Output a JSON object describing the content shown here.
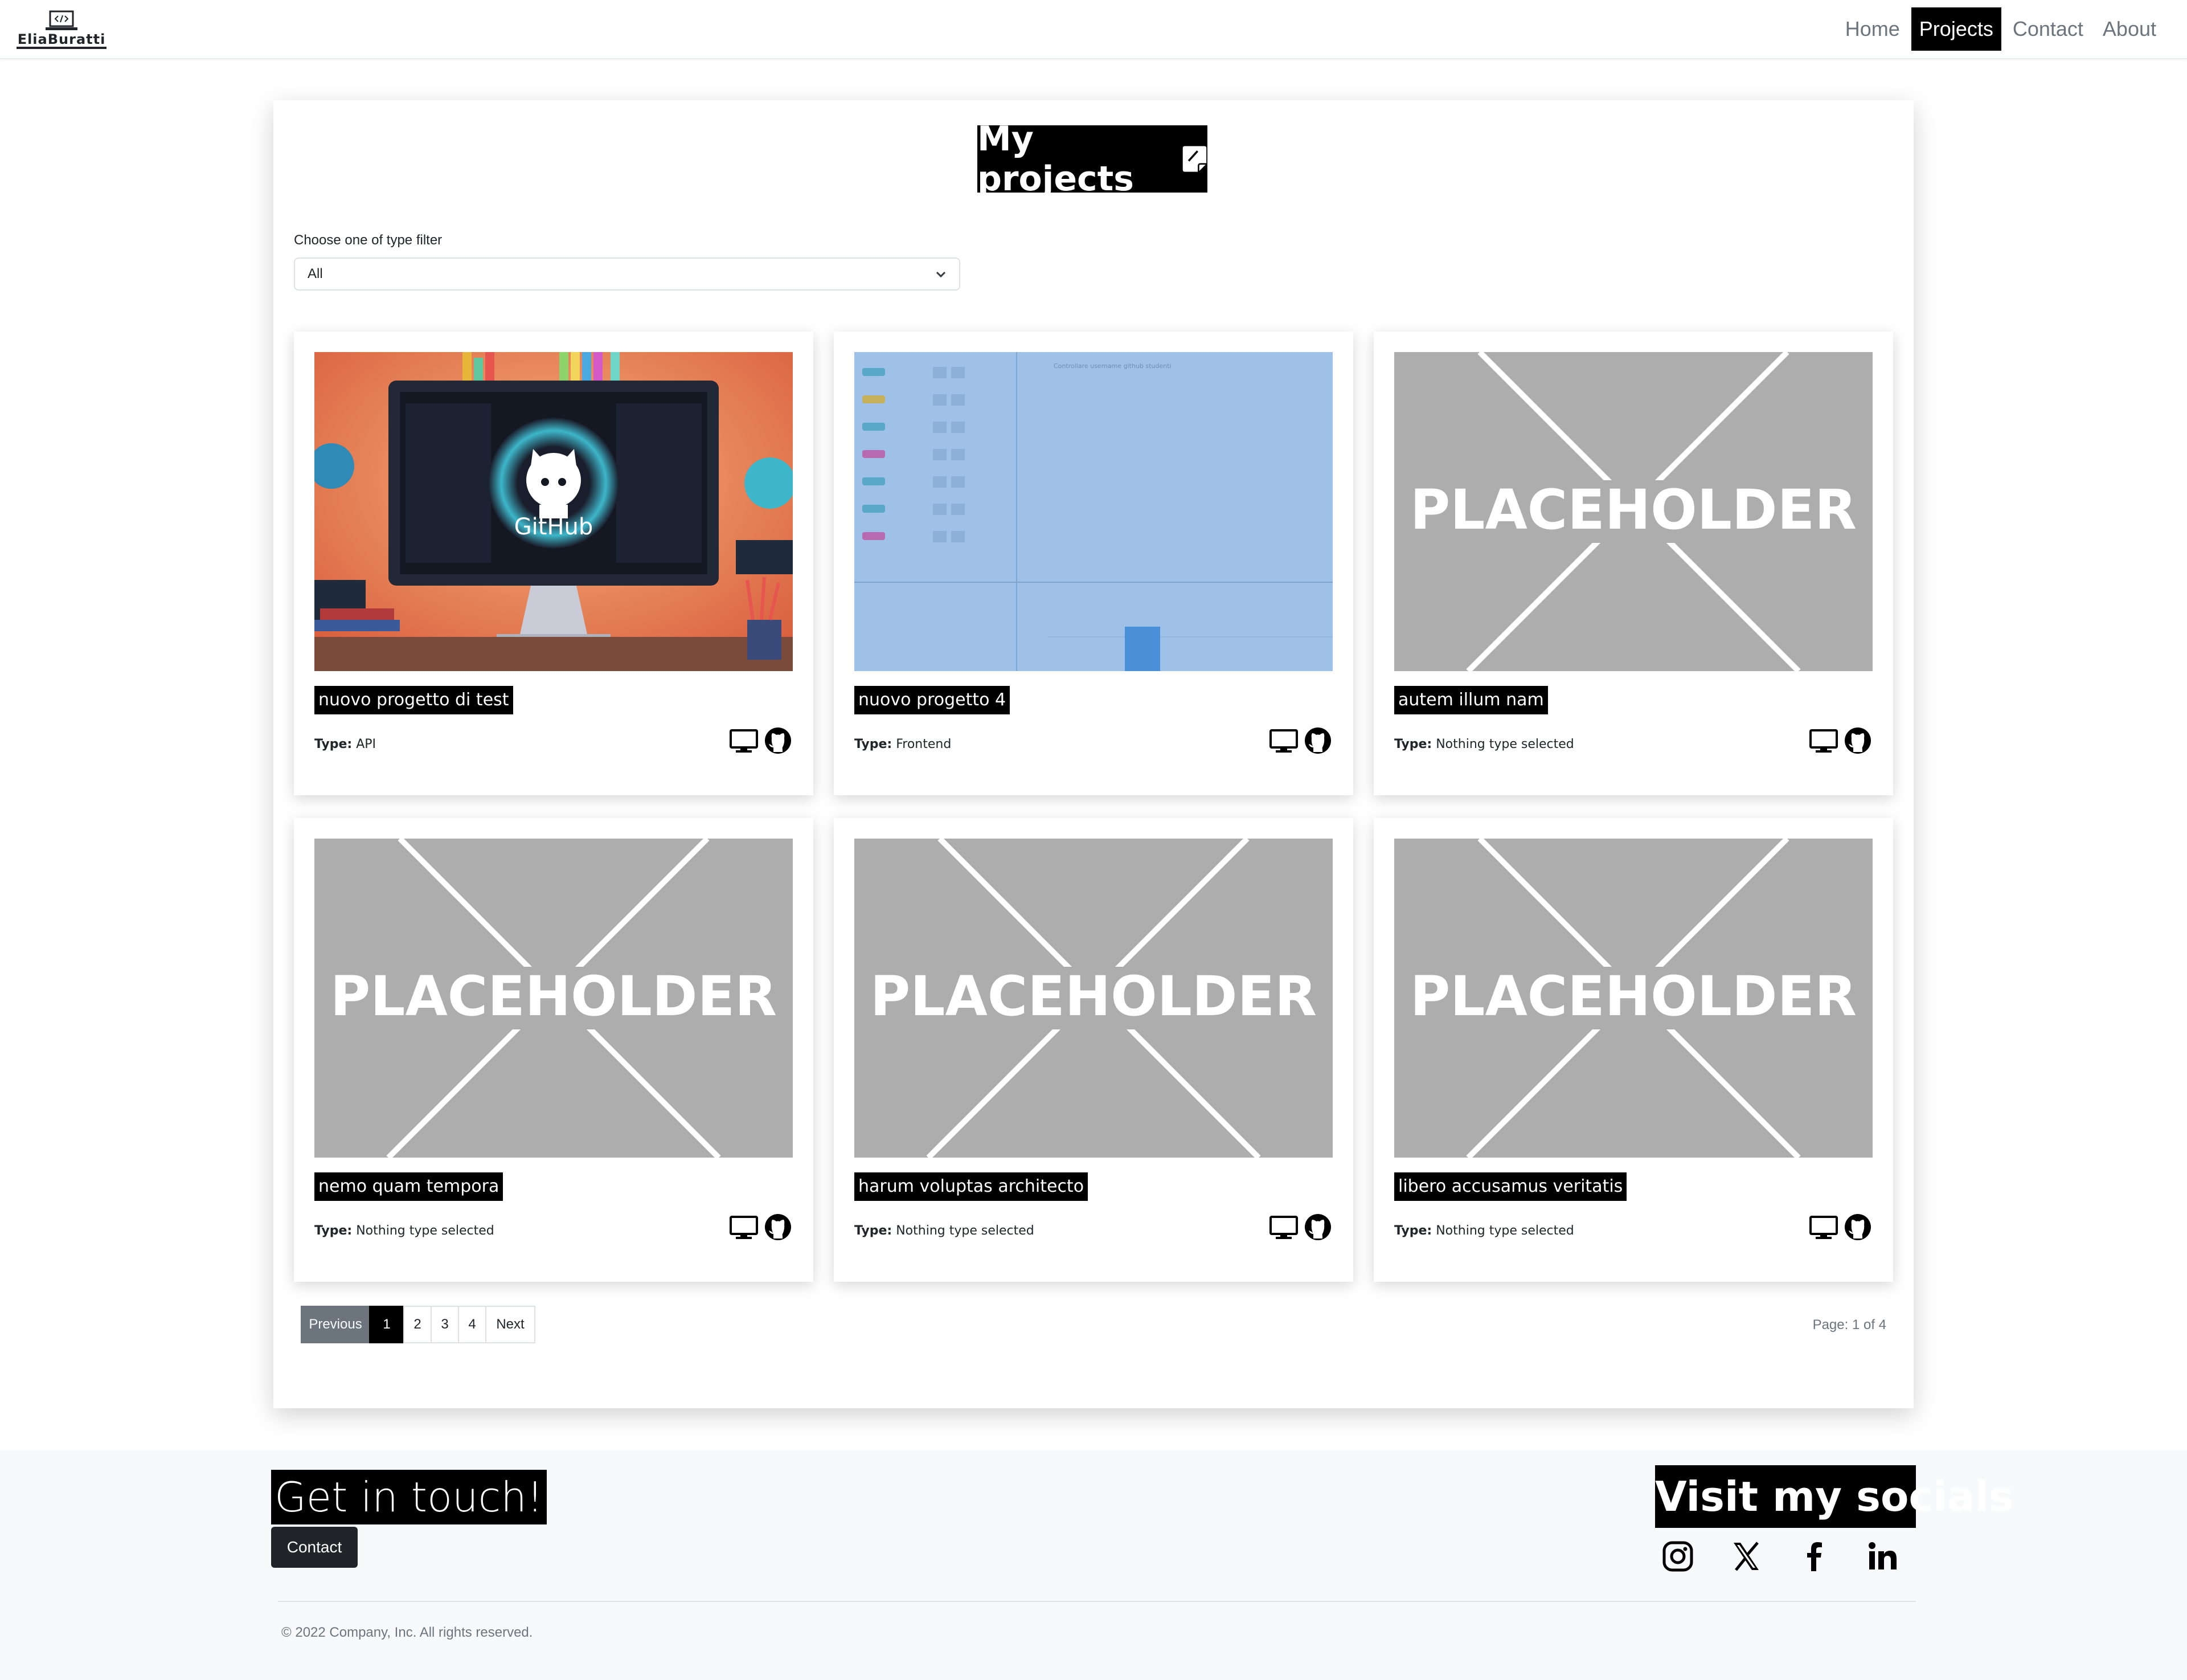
{
  "navbar": {
    "logo_text": "EliaBuratti",
    "links": [
      {
        "label": "Home",
        "active": false
      },
      {
        "label": "Projects",
        "active": true
      },
      {
        "label": "Contact",
        "active": false
      },
      {
        "label": "About",
        "active": false
      }
    ]
  },
  "main": {
    "title": "My projects",
    "filter": {
      "label": "Choose one of type filter",
      "selected": "All"
    },
    "projects": [
      {
        "title": "nuovo progetto di test",
        "type_label": "Type:",
        "type_value": "API",
        "image": "github-illustration"
      },
      {
        "title": "nuovo progetto 4",
        "type_label": "Type:",
        "type_value": "Frontend",
        "image": "blue-dashboard-screenshot",
        "image_caption": "Controllare username github studenti"
      },
      {
        "title": "autem illum nam",
        "type_label": "Type:",
        "type_value": "Nothing type selected",
        "image": "placeholder"
      },
      {
        "title": "nemo quam tempora",
        "type_label": "Type:",
        "type_value": "Nothing type selected",
        "image": "placeholder"
      },
      {
        "title": "harum voluptas architecto",
        "type_label": "Type:",
        "type_value": "Nothing type selected",
        "image": "placeholder"
      },
      {
        "title": "libero accusamus veritatis",
        "type_label": "Type:",
        "type_value": "Nothing type selected",
        "image": "placeholder"
      }
    ],
    "placeholder_text": "PLACEHOLDER",
    "github_image_text": "GitHub",
    "project_icons": [
      "monitor-icon",
      "github-icon"
    ],
    "pagination": {
      "previous": "Previous",
      "pages": [
        "1",
        "2",
        "3",
        "4"
      ],
      "current": "1",
      "next": "Next",
      "info": "Page: 1 of 4"
    }
  },
  "footer": {
    "left_title": "Get in touch!",
    "contact_button": "Contact",
    "right_title": "Visit my socials",
    "socials": [
      "instagram-icon",
      "x-icon",
      "facebook-icon",
      "linkedin-icon"
    ],
    "copyright": "© 2022 Company, Inc. All rights reserved."
  },
  "colors": {
    "accent": "#000000",
    "placeholder_bg": "#adadad",
    "dashboard_blue": "#9fc1e7",
    "footer_bg": "#f8f9fa"
  }
}
